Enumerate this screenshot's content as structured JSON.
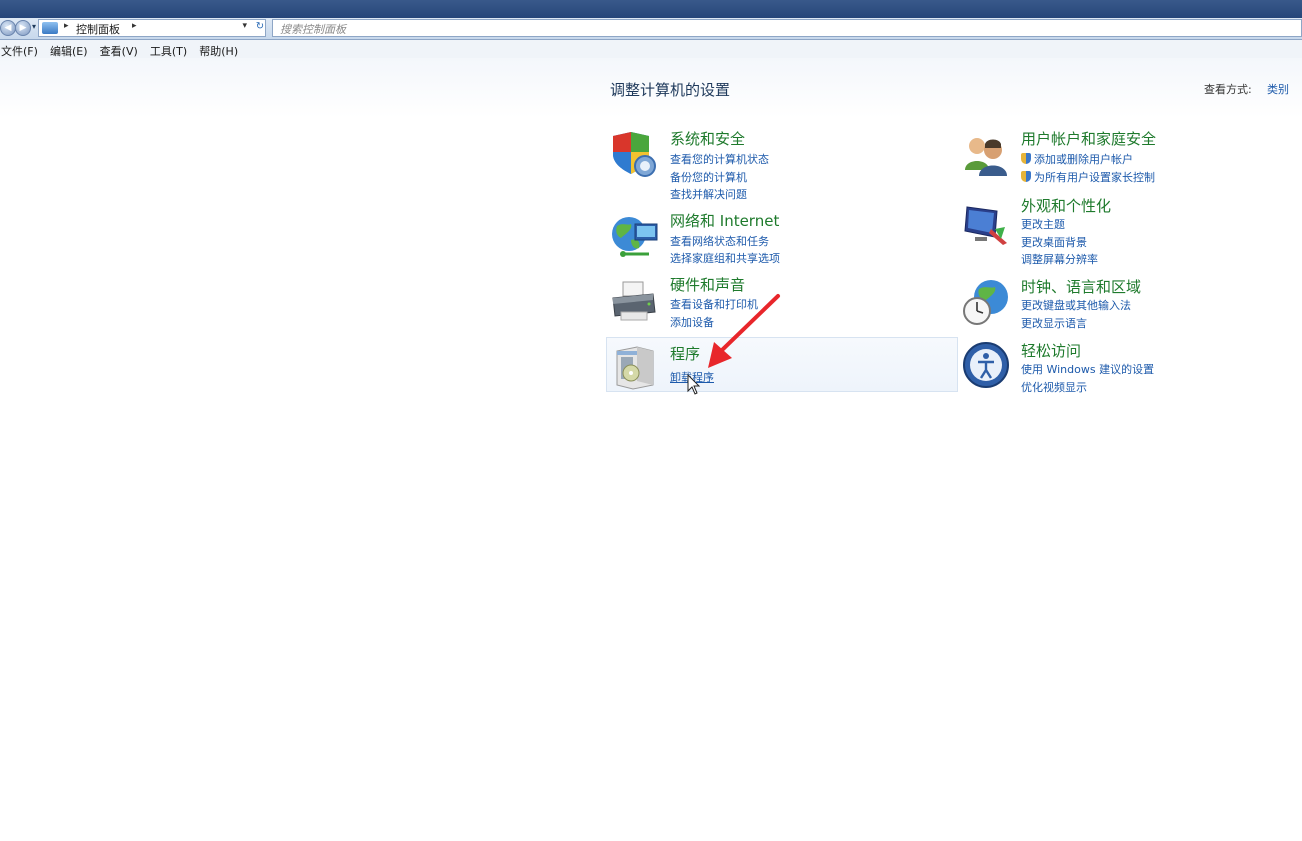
{
  "address_bar": {
    "path": [
      "控制面板"
    ],
    "search_placeholder": "搜索控制面板"
  },
  "menu": [
    "文件(F)",
    "编辑(E)",
    "查看(V)",
    "工具(T)",
    "帮助(H)"
  ],
  "page": {
    "title": "调整计算机的设置",
    "view_by_label": "查看方式:",
    "view_by_value": "类别"
  },
  "categories": [
    {
      "title": "系统和安全",
      "icon": "shield-computer-icon",
      "links": [
        "查看您的计算机状态",
        "备份您的计算机",
        "查找并解决问题"
      ]
    },
    {
      "title": "网络和 Internet",
      "icon": "network-globe-icon",
      "links": [
        "查看网络状态和任务",
        "选择家庭组和共享选项"
      ]
    },
    {
      "title": "硬件和声音",
      "icon": "printer-icon",
      "links": [
        "查看设备和打印机",
        "添加设备"
      ]
    },
    {
      "title": "程序",
      "icon": "programs-box-icon",
      "links": [
        "卸载程序"
      ]
    },
    {
      "title": "用户帐户和家庭安全",
      "icon": "users-icon",
      "links": [
        "添加或删除用户帐户",
        "为所有用户设置家长控制"
      ]
    },
    {
      "title": "外观和个性化",
      "icon": "monitor-paint-icon",
      "links": [
        "更改主题",
        "更改桌面背景",
        "调整屏幕分辨率"
      ]
    },
    {
      "title": "时钟、语言和区域",
      "icon": "clock-globe-icon",
      "links": [
        "更改键盘或其他输入法",
        "更改显示语言"
      ]
    },
    {
      "title": "轻松访问",
      "icon": "ease-of-access-icon",
      "links": [
        "使用 Windows 建议的设置",
        "优化视频显示"
      ]
    }
  ],
  "colors": {
    "category_title": "#1e7a2c",
    "link": "#1d5aab",
    "annotation_arrow": "#e8262b"
  }
}
